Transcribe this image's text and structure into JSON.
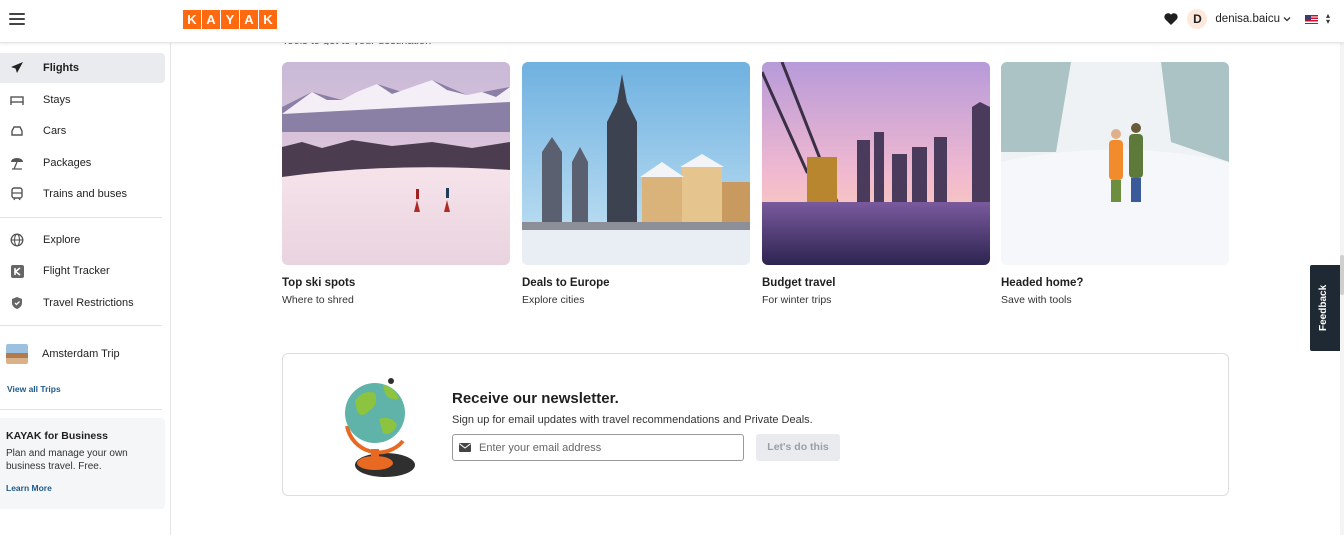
{
  "header": {
    "logo_letters": [
      "K",
      "A",
      "Y",
      "A",
      "K"
    ],
    "avatar_initial": "D",
    "username": "denisa.baicu",
    "icons": {
      "menu": "hamburger-icon",
      "favorites": "heart-icon",
      "dropdown": "chevron-down-icon",
      "locale": "us-flag-icon"
    }
  },
  "sidebar": {
    "primary": [
      {
        "label": "Flights",
        "icon": "plane-icon",
        "active": true
      },
      {
        "label": "Stays",
        "icon": "bed-icon"
      },
      {
        "label": "Cars",
        "icon": "car-icon"
      },
      {
        "label": "Packages",
        "icon": "umbrella-icon"
      },
      {
        "label": "Trains and buses",
        "icon": "train-icon"
      }
    ],
    "secondary": [
      {
        "label": "Explore",
        "icon": "globe-icon"
      },
      {
        "label": "Flight Tracker",
        "icon": "kayak-k-icon"
      },
      {
        "label": "Travel Restrictions",
        "icon": "shield-icon"
      }
    ],
    "trip": {
      "label": "Amsterdam Trip"
    },
    "view_all_trips": "View all Trips",
    "business": {
      "title": "KAYAK for Business",
      "text": "Plan and manage your own business travel. Free.",
      "link": "Learn More"
    }
  },
  "main": {
    "section_subtitle": "Tools to get to your destination",
    "cards": [
      {
        "title": "Top ski spots",
        "subtitle": "Where to shred"
      },
      {
        "title": "Deals to Europe",
        "subtitle": "Explore cities"
      },
      {
        "title": "Budget travel",
        "subtitle": "For winter trips"
      },
      {
        "title": "Headed home?",
        "subtitle": "Save with tools"
      }
    ],
    "newsletter": {
      "title": "Receive our newsletter.",
      "subtitle": "Sign up for email updates with travel recommendations and Private Deals.",
      "email_placeholder": "Enter your email address",
      "button": "Let's do this"
    }
  },
  "feedback": "Feedback",
  "colors": {
    "brand": "#ff690f",
    "nav_active": "#e9ebee",
    "link": "#1f5a8a",
    "feedback_bg": "#1f2933"
  }
}
